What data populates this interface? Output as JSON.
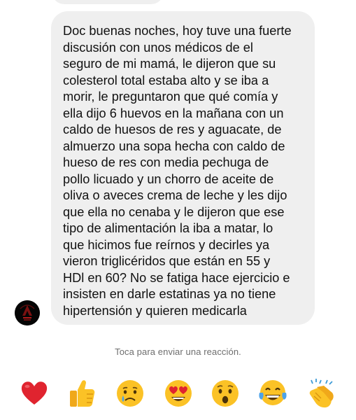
{
  "conversation": {
    "message": {
      "text": "Doc buenas noches, hoy tuve una fuerte\ndiscusión con unos médicos de el\nseguro de mi mamá, le dijeron que su\ncolesterol total estaba alto y se iba a\nmorir, le preguntaron que qué comía y\nella dijo 6 huevos en la mañana con un\ncaldo de huesos de res y aguacate, de\nalmuerzo una sopa hecha con caldo de\nhueso de res con media pechuga de\npollo licuado y un chorro de aceite de\noliva o aveces crema de leche y les dijo\nque ella no cenaba y le dijeron que ese\ntipo de alimentación la iba a matar, lo\nque hicimos fue reírnos y decirles ya\nvieron triglicéridos que están en 55 y\nHDl en 60? No se fatiga hace ejercicio e\ninsisten en darle estatinas ya no tiene\nhipertensión y quieren medicarla"
    }
  },
  "reaction_hint": "Toca para enviar una reacción.",
  "reactions": [
    {
      "icon": "red-heart-icon",
      "label": "❤"
    },
    {
      "icon": "thumbs-up-icon",
      "label": "👍"
    },
    {
      "icon": "crying-face-icon",
      "label": "😢"
    },
    {
      "icon": "heart-eyes-face-icon",
      "label": "😍"
    },
    {
      "icon": "surprised-face-icon",
      "label": "😮"
    },
    {
      "icon": "tears-of-joy-face-icon",
      "label": "😂"
    },
    {
      "icon": "clapping-hands-icon",
      "label": "👏"
    }
  ],
  "colors": {
    "bubble": "#efefef",
    "text": "#111111",
    "hint": "#6e6e6e",
    "heart": "#e0242f",
    "emoji_face": "#fbc226"
  }
}
